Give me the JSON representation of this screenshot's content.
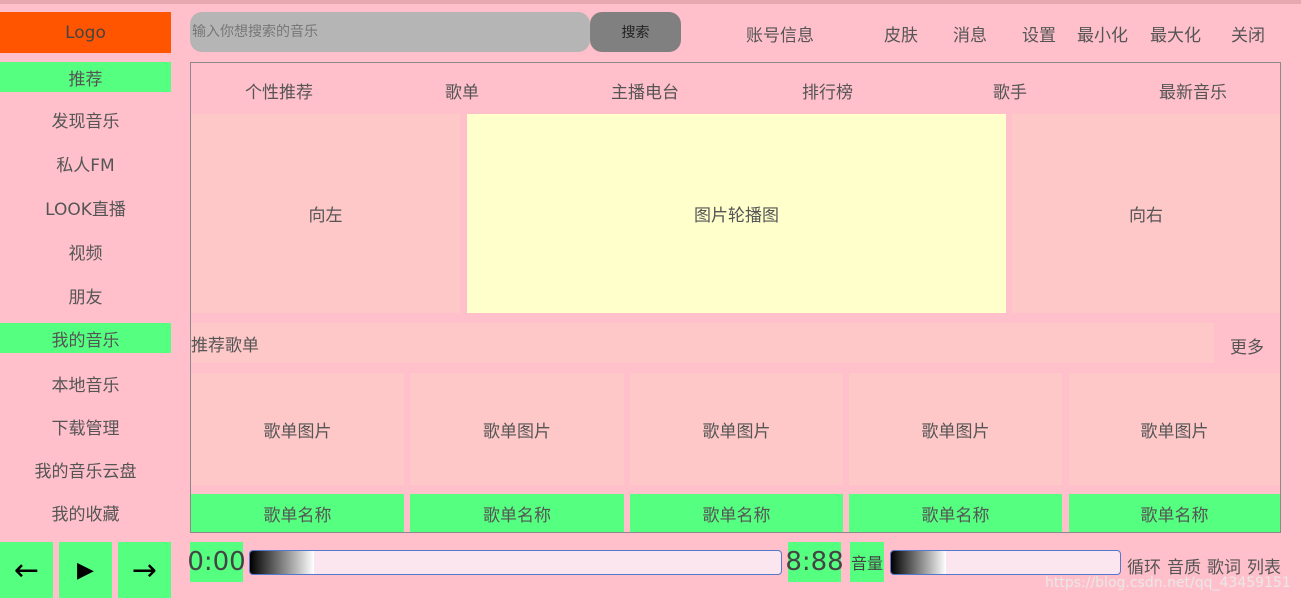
{
  "sidebar": {
    "logo": "Logo",
    "items": [
      {
        "label": "推荐",
        "highlight": true
      },
      {
        "label": "发现音乐"
      },
      {
        "label": "私人FM"
      },
      {
        "label": "LOOK直播"
      },
      {
        "label": "视频"
      },
      {
        "label": "朋友"
      },
      {
        "label": "我的音乐",
        "highlight": true
      },
      {
        "label": "本地音乐"
      },
      {
        "label": "下载管理"
      },
      {
        "label": "我的音乐云盘"
      },
      {
        "label": "我的收藏"
      }
    ]
  },
  "header": {
    "search_placeholder": "输入你想搜索的音乐",
    "search_button": "搜索",
    "links": [
      "账号信息",
      "皮肤",
      "消息",
      "设置",
      "最小化",
      "最大化",
      "关闭"
    ]
  },
  "tabs": [
    "个性推荐",
    "歌单",
    "主播电台",
    "排行榜",
    "歌手",
    "最新音乐"
  ],
  "carousel": {
    "left": "向左",
    "center": "图片轮播图",
    "right": "向右"
  },
  "recommend": {
    "title": "推荐歌单",
    "more": "更多",
    "playlists": [
      {
        "image": "歌单图片",
        "name": "歌单名称"
      },
      {
        "image": "歌单图片",
        "name": "歌单名称"
      },
      {
        "image": "歌单图片",
        "name": "歌单名称"
      },
      {
        "image": "歌单图片",
        "name": "歌单名称"
      },
      {
        "image": "歌单图片",
        "name": "歌单名称"
      }
    ]
  },
  "player": {
    "prev_icon": "←",
    "play_icon": "▶",
    "next_icon": "→",
    "current_time": "0:00",
    "total_time": "8:88",
    "volume_label": "音量",
    "progress": 0.12,
    "volume": 0.24,
    "options": [
      "循环",
      "音质",
      "歌词",
      "列表"
    ]
  },
  "watermark": "https://blog.csdn.net/qq_43459151",
  "colors": {
    "background": "#ffc0cb",
    "accent_green": "#55ff80",
    "logo_orange": "#ff5500",
    "carousel_center": "#ffffcc",
    "panel_pink": "#ffc8c8"
  }
}
